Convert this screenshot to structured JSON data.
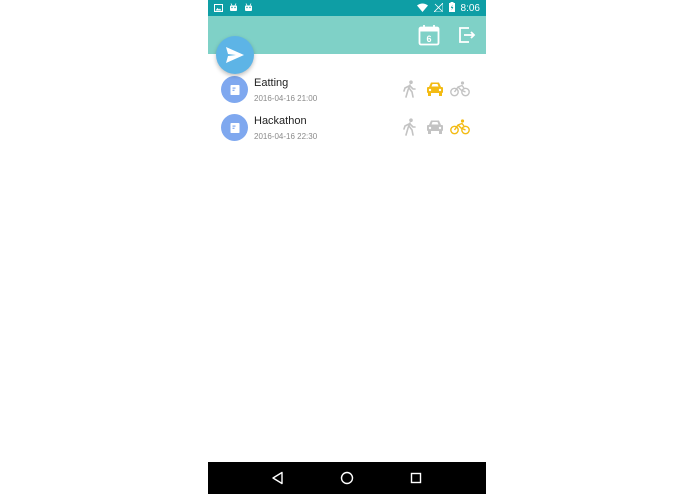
{
  "status_bar": {
    "time": "8:06",
    "left_icons": [
      "image-icon",
      "android-icon",
      "android-icon"
    ],
    "right_icons": [
      "wifi-icon",
      "no-signal-icon",
      "battery-charging-icon"
    ],
    "color": "#0e9ea5"
  },
  "toolbar": {
    "color": "#7fd1c7",
    "calendar_day": "6",
    "icons": [
      "calendar-icon",
      "logout-icon"
    ]
  },
  "fab": {
    "icon": "send-icon",
    "color": "#5db4e6"
  },
  "events": [
    {
      "title": "Eatting",
      "datetime": "2016-04-16 21:00",
      "selected_mode": "car"
    },
    {
      "title": "Hackathon",
      "datetime": "2016-04-16 22:30",
      "selected_mode": "bike"
    }
  ],
  "transport_modes": [
    "walk",
    "car",
    "bike"
  ],
  "colors": {
    "mode_selected": "#f3bb13",
    "mode_unselected": "#c3c3c3",
    "avatar": "#7fa8ef"
  },
  "nav_bar": {
    "buttons": [
      "back-icon",
      "home-icon",
      "recents-icon"
    ]
  }
}
